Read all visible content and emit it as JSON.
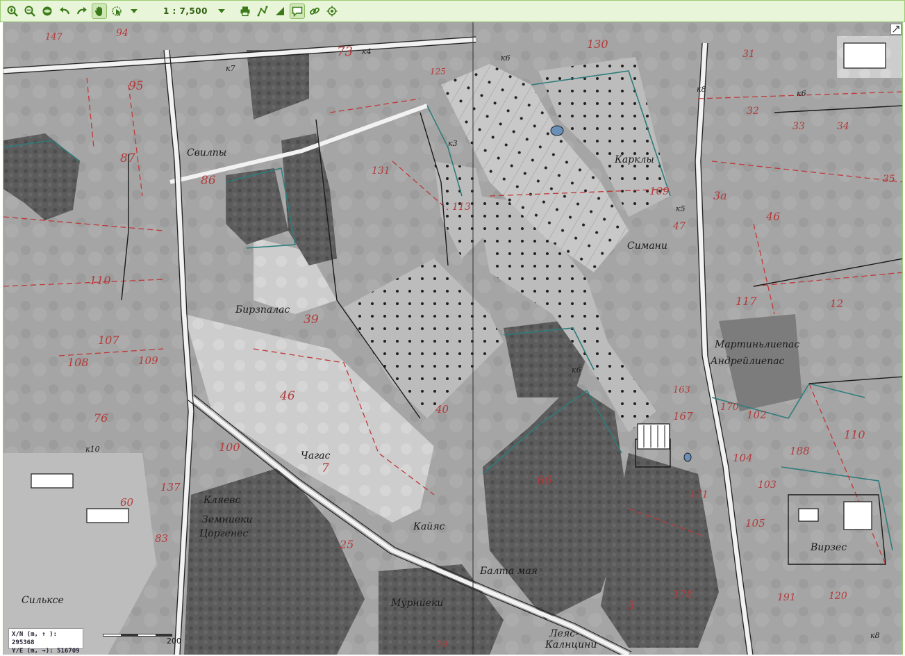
{
  "toolbar": {
    "buttons": [
      {
        "name": "zoom-in-icon"
      },
      {
        "name": "zoom-out-icon"
      },
      {
        "name": "full-extent-icon"
      },
      {
        "name": "undo-icon"
      },
      {
        "name": "redo-icon"
      },
      {
        "name": "pan-hand-icon",
        "active": true
      },
      {
        "name": "select-icon"
      },
      {
        "name": "dropdown-arrow-icon"
      }
    ],
    "scale_label": "1 : 7,500",
    "right_buttons": [
      {
        "name": "dropdown-arrow-icon"
      },
      {
        "name": "print-icon"
      },
      {
        "name": "measure-line-icon"
      },
      {
        "name": "measure-area-icon"
      },
      {
        "name": "comment-icon",
        "active": true
      },
      {
        "name": "link-icon"
      },
      {
        "name": "gps-icon"
      }
    ]
  },
  "map": {
    "place_labels": [
      "Свилпы",
      "Бирзпалас",
      "Карклы",
      "Симани",
      "Мартиньлиепас",
      "Андрейлиепас",
      "Чагас",
      "Кайяс",
      "Балта мая",
      "Мурниеки",
      "Земниеки",
      "Цоргенес",
      "Кляевс",
      "Вирзес",
      "Сильксе",
      "Леяс-",
      "Калнцини"
    ],
    "parcel_numbers": [
      "73",
      "95",
      "87",
      "86",
      "110",
      "107",
      "108",
      "109",
      "76",
      "100",
      "137",
      "60",
      "83",
      "39",
      "46",
      "40",
      "7",
      "25",
      "66",
      "130",
      "131",
      "113",
      "109",
      "47",
      "163",
      "167",
      "170",
      "102",
      "104",
      "103",
      "105",
      "188",
      "110",
      "178",
      "3",
      "171",
      "191",
      "120",
      "117",
      "12",
      "46",
      "32",
      "33",
      "34",
      "35",
      "31",
      "3а",
      "94",
      "147",
      "125",
      "79"
    ],
    "road_codes": [
      "к8",
      "к6",
      "к5",
      "к4",
      "к3",
      "к7",
      "к10"
    ],
    "colors": {
      "parcel_line": "#c03838",
      "contour": "#2e7c7c",
      "ink": "#1a1a1a"
    }
  },
  "coords": {
    "xn_label": "X/N (m, ↑ ):",
    "xn_value": "295368",
    "ye_label": "Y/E (m, →):",
    "ye_value": "516709"
  },
  "scalebar": {
    "label": "200"
  }
}
